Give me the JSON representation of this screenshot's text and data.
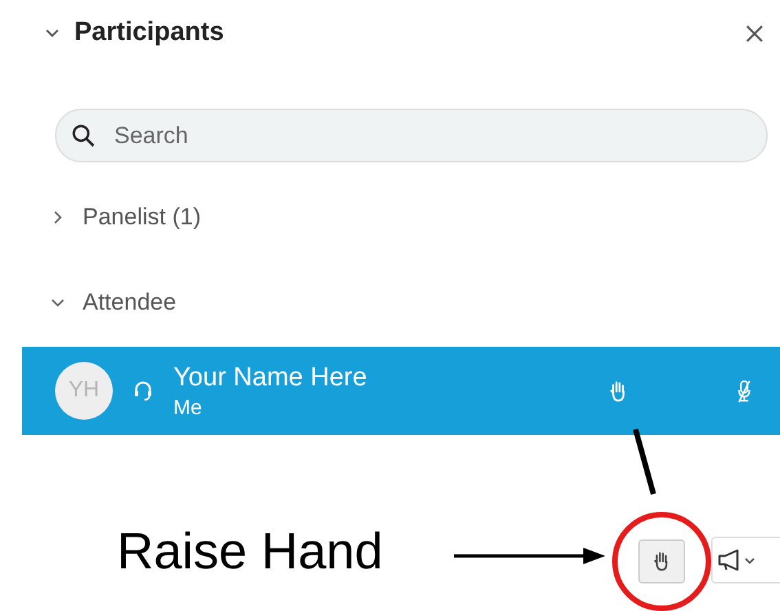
{
  "panel": {
    "title": "Participants",
    "expanded": true
  },
  "search": {
    "placeholder": "Search"
  },
  "groups": [
    {
      "label": "Panelist (1)",
      "expanded": false
    },
    {
      "label": "Attendee",
      "expanded": true,
      "participants": [
        {
          "initials": "YH",
          "name": "Your Name Here",
          "role": "Me",
          "selected": true
        }
      ]
    }
  ],
  "annotation": {
    "label": "Raise Hand"
  }
}
